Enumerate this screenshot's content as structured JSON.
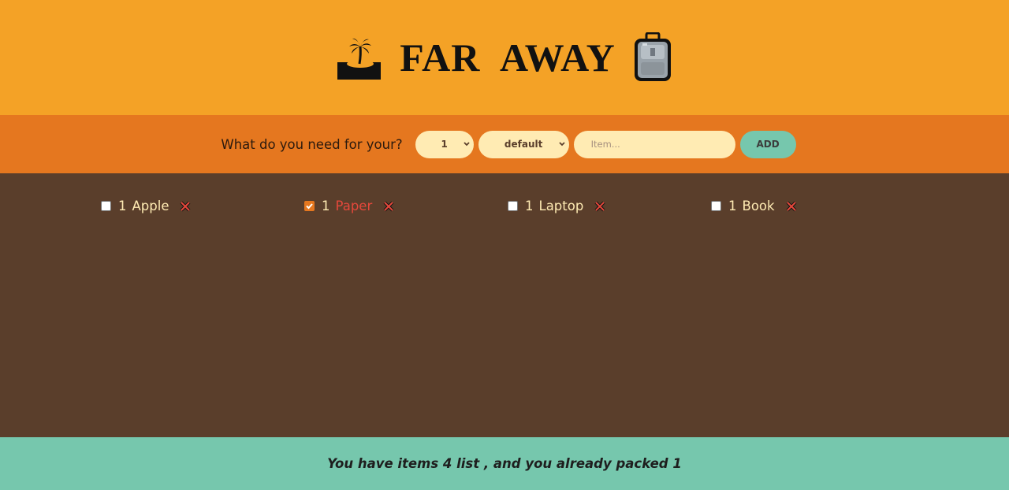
{
  "header": {
    "title": "FAR AWAY",
    "left_icon": "desert-island-icon",
    "right_icon": "luggage-icon",
    "background": "#f4a226"
  },
  "form": {
    "prompt": "What do you need for your?",
    "quantity_value": "1",
    "sort_value": "default",
    "item_placeholder": "Item...",
    "add_label": "ADD",
    "background": "#e5771f"
  },
  "items": [
    {
      "quantity": "1",
      "name": "Apple",
      "packed": false
    },
    {
      "quantity": "1",
      "name": "Paper",
      "packed": true
    },
    {
      "quantity": "1",
      "name": "Laptop",
      "packed": false
    },
    {
      "quantity": "1",
      "name": "Book",
      "packed": false
    }
  ],
  "footer": {
    "stats": "You have items 4 list , and you already packed 1",
    "background": "#76c7ad"
  },
  "colors": {
    "list_background": "#5a3e2b",
    "item_text": "#ffebb3",
    "packed_text": "#e5483b",
    "delete_icon": "#e5483b"
  }
}
